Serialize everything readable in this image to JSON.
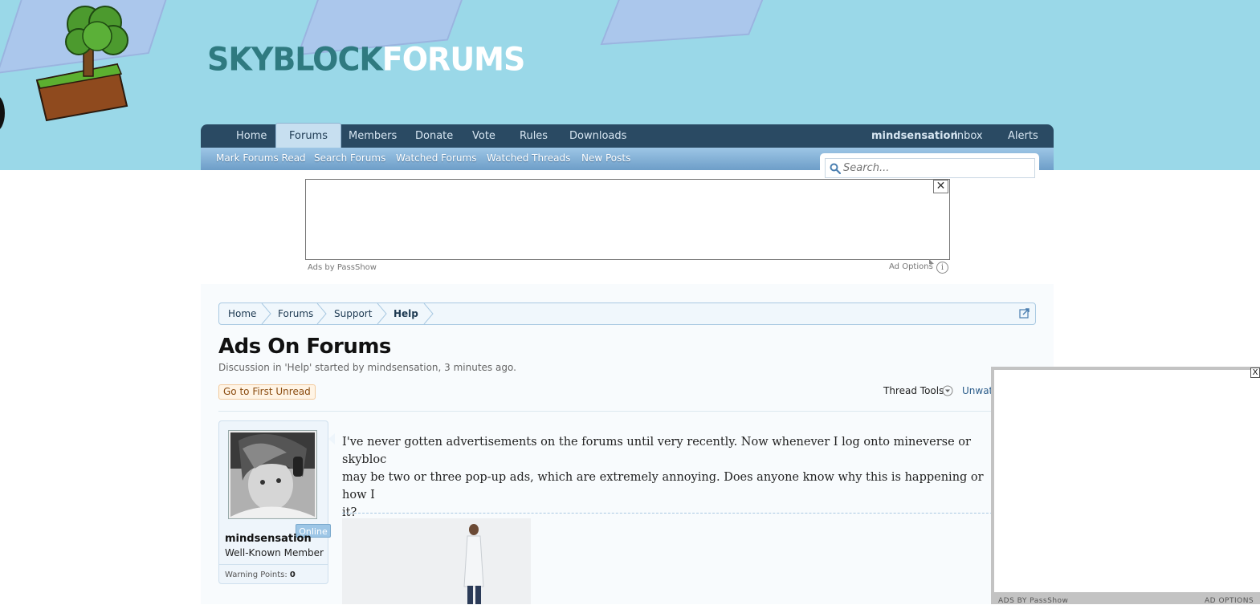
{
  "colors": {
    "header_bg": "#9ad8e8",
    "nav_bg": "#2a4a63",
    "subnav_bg": "#7faed6",
    "link": "#2b5c8a"
  },
  "header": {
    "logo_part1": "SKYBLOCK",
    "logo_part2": "FORUMS"
  },
  "nav": {
    "tabs": [
      {
        "label": "Home"
      },
      {
        "label": "Forums",
        "active": true
      },
      {
        "label": "Members"
      },
      {
        "label": "Donate"
      },
      {
        "label": "Vote"
      },
      {
        "label": "Rules"
      },
      {
        "label": "Downloads"
      }
    ],
    "user": "mindsensation",
    "inbox": "Inbox",
    "alerts": "Alerts"
  },
  "subnav": {
    "links": [
      {
        "label": "Mark Forums Read"
      },
      {
        "label": "Search Forums"
      },
      {
        "label": "Watched Forums"
      },
      {
        "label": "Watched Threads"
      },
      {
        "label": "New Posts"
      }
    ]
  },
  "search": {
    "placeholder": "Search..."
  },
  "ad_top": {
    "close": "✕",
    "ads_by": "Ads by PassShow",
    "options": "Ad Options",
    "info": "i"
  },
  "breadcrumb": {
    "items": [
      {
        "label": "Home"
      },
      {
        "label": "Forums"
      },
      {
        "label": "Support"
      },
      {
        "label": "Help"
      }
    ]
  },
  "thread": {
    "title": "Ads On Forums",
    "subtitle": "Discussion in 'Help' started by mindsensation, 3 minutes ago.",
    "first_unread": "Go to First Unread",
    "thread_tools": "Thread Tools",
    "unwatch": "Unwat"
  },
  "post": {
    "username": "mindsensation",
    "user_title": "Well-Known Member",
    "online": "Online",
    "warning_label": "Warning Points:",
    "warning_points": "0",
    "message_line1": "I've never gotten advertisements on the forums until very recently. Now whenever I log onto mineverse or skybloc",
    "message_line2": "may be two or three pop-up ads, which are extremely annoying. Does anyone know why this is happening or how I",
    "message_line3": "it?"
  },
  "popup_ad": {
    "close": "X",
    "footer_left": "ADS BY PassShow",
    "footer_right": "AD OPTIONS"
  }
}
